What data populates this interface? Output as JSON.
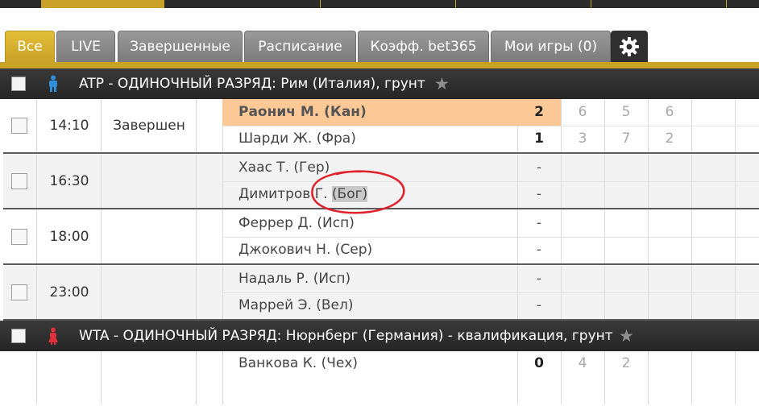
{
  "tabs": [
    {
      "label": "Все",
      "active": true
    },
    {
      "label": "LIVE"
    },
    {
      "label": "Завершенные"
    },
    {
      "label": "Расписание"
    },
    {
      "label": "Коэфф. bet365"
    },
    {
      "label": "Мои игры (0)"
    }
  ],
  "sections": [
    {
      "title": "ATP - ОДИНОЧНЫЙ РАЗРЯД: Рим (Италия), грунт",
      "icon": "male-player-icon",
      "icon_color": "#2f8fd8"
    },
    {
      "title": "WTA - ОДИНОЧНЫЙ РАЗРЯД: Нюрнберг (Германия) - квалификация, грунт",
      "icon": "female-player-icon",
      "icon_color": "#e0303a"
    }
  ],
  "matches": [
    {
      "time": "14:10",
      "status": "Завершен",
      "p1": "Раонич М. (Кан)",
      "p2": "Шарди Ж. (Фра)",
      "s1": "2",
      "s2": "1",
      "sets1": [
        "6",
        "5",
        "6"
      ],
      "sets2": [
        "3",
        "7",
        "2"
      ]
    },
    {
      "time": "16:30",
      "status": "",
      "p1": "Хаас Т. (Гер)",
      "p2_name": "Димитров Г. ",
      "p2_hl": "(Бог)",
      "s1": "-",
      "s2": "-"
    },
    {
      "time": "18:00",
      "status": "",
      "p1": "Феррер Д. (Исп)",
      "p2": "Джокович Н. (Сер)",
      "s1": "-",
      "s2": "-"
    },
    {
      "time": "23:00",
      "status": "",
      "p1": "Надаль Р. (Исп)",
      "p2": "Маррей Э. (Вел)",
      "s1": "-",
      "s2": "-"
    }
  ],
  "partial_match": {
    "p1": "Ванкова К. (Чех)",
    "s1": "0",
    "sets1": [
      "4",
      "2"
    ]
  },
  "colors": {
    "accent": "#c9a227",
    "winner_bg": "#fcc896",
    "annotation": "#e0202a"
  }
}
